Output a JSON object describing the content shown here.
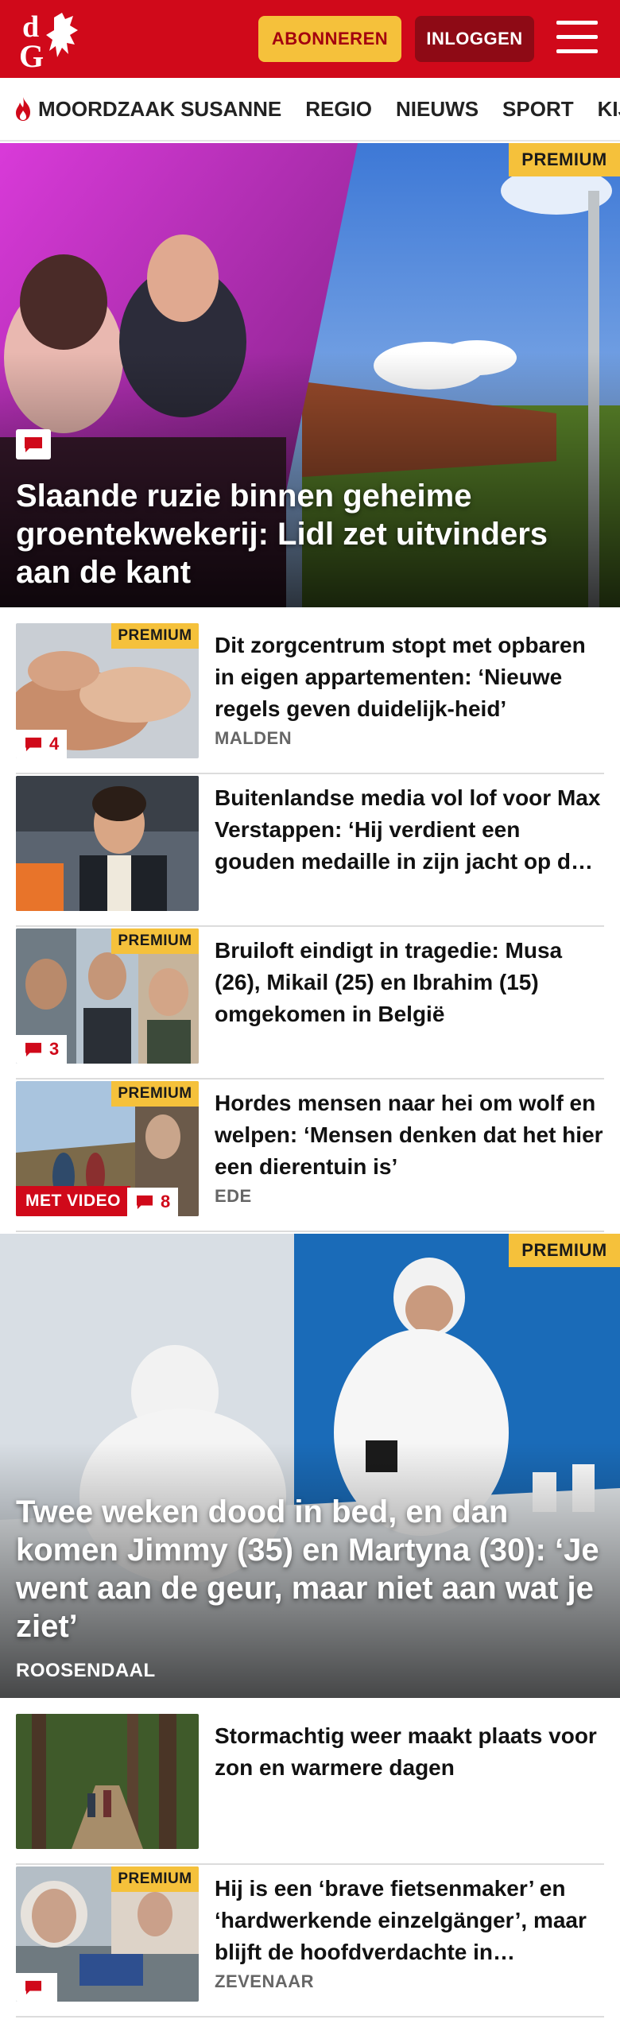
{
  "header": {
    "subscribe_label": "ABONNEREN",
    "login_label": "INLOGGEN"
  },
  "nav": {
    "items": [
      "MOORDZAAK SUSANNE",
      "REGIO",
      "NIEUWS",
      "SPORT",
      "KIJK"
    ]
  },
  "premium_label": "PREMIUM",
  "hero1": {
    "title": "Slaande ruzie binnen geheime groentekwekerij: Lidl zet uitvinders aan de kant"
  },
  "articles": [
    {
      "title": "Dit zorgcentrum stopt met opbaren in eigen appartementen: ‘Nieuwe regels geven duidelijk-heid’",
      "location": "MALDEN",
      "comments": "4"
    },
    {
      "title": "Buitenlandse media vol lof voor Max Verstappen: ‘Hij verdient een gouden medaille in zijn jacht op de wereldtitel’"
    },
    {
      "title": "Bruiloft eindigt in tragedie: Musa (26), Mikail (25) en Ibrahim (15) omgekomen in België",
      "comments": "3"
    },
    {
      "title": "Hordes mensen naar hei om wolf en welpen: ‘Mensen denken dat het hier een dierentuin is’",
      "location": "EDE",
      "video_label": "MET VIDEO",
      "comments": "8"
    }
  ],
  "hero2": {
    "title": "Twee weken dood in bed, en dan komen Jimmy (35) en Martyna (30): ‘Je went aan de geur, maar niet aan wat je ziet’",
    "location": "ROOSENDAAL"
  },
  "articles2": [
    {
      "title": "Stormachtig weer maakt plaats voor zon en warmere dagen"
    },
    {
      "title": "Hij is een ‘brave fietsenmaker’ en ‘hardwerkende einzelgänger’, maar blijft de hoofdverdachte in moordzaak",
      "location": "ZEVENAAR"
    }
  ],
  "colors": {
    "brand_red": "#d0091a",
    "premium_yellow": "#f5c13b",
    "login_dark_red": "#8e0a15"
  }
}
